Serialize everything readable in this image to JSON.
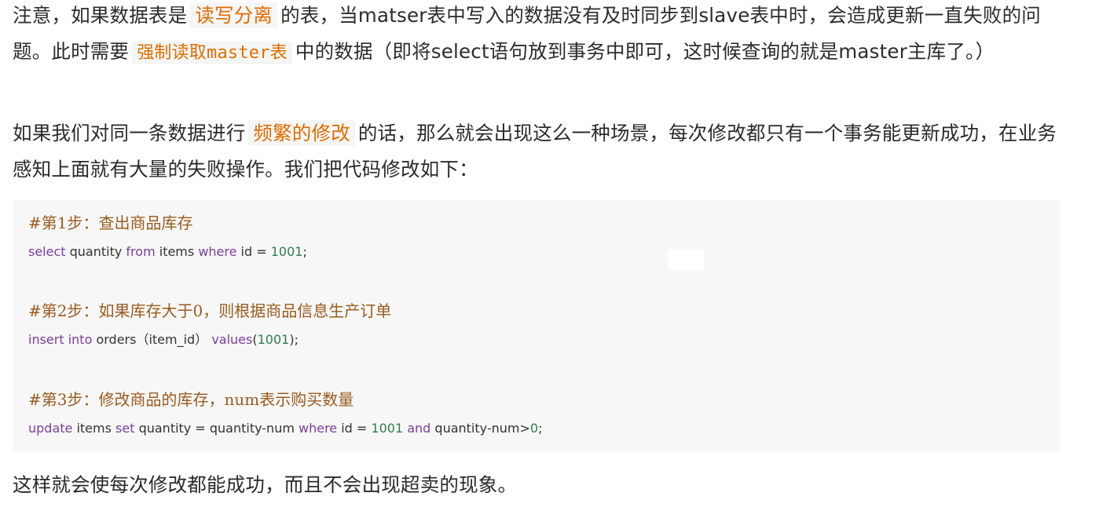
{
  "paragraph1": {
    "t1": "注意，如果数据表是",
    "h1": "读写分离",
    "t2": "的表，当matser表中写入的数据没有及时同步到slave表中时，会造成更新一直失败的问题。此时需要",
    "h2": "强制读取master表",
    "t3": "中的数据（即将select语句放到事务中即可，这时候查询的就是master主库了。）"
  },
  "paragraph2": {
    "t1": "如果我们对同一条数据进行",
    "h1": "频繁的修改",
    "t2": "的话，那么就会出现这么一种场景，每次修改都只有一个事务能更新成功，在业务感知上面就有大量的失败操作。我们把代码修改如下："
  },
  "code": {
    "c1": "#第1步：查出商品库存",
    "l2": {
      "k1": "select",
      "t1": " quantity ",
      "k2": "from",
      "t2": " items ",
      "k3": "where",
      "t3": " id = ",
      "n1": "1001",
      "t4": ";"
    },
    "c2": "#第2步：如果库存大于0，则根据商品信息生产订单",
    "l4": {
      "k1": "insert",
      "t1": " ",
      "k2": "into",
      "t2": " orders（item_id） ",
      "k3": "values",
      "t3": "(",
      "n1": "1001",
      "t4": ");"
    },
    "c3": "#第3步：修改商品的库存，num表示购买数量",
    "l6": {
      "k1": "update",
      "t1": " items ",
      "k2": "set",
      "t2": " quantity = quantity-num ",
      "k3": "where",
      "t3": " id = ",
      "n1": "1001",
      "t4": " ",
      "k4": "and",
      "t5": " quantity-num>",
      "n2": "0",
      "t6": ";"
    }
  },
  "paragraph3": {
    "text": "这样就会使每次修改都能成功，而且不会出现超卖的现象。"
  },
  "colors": {
    "highlight_text": "#e06d00",
    "highlight_bg": "#f6f6f6",
    "code_bg": "#f7f7f7",
    "keyword": "#7a3e9d",
    "comment": "#9a5b1e",
    "number": "#2e7d4f"
  }
}
